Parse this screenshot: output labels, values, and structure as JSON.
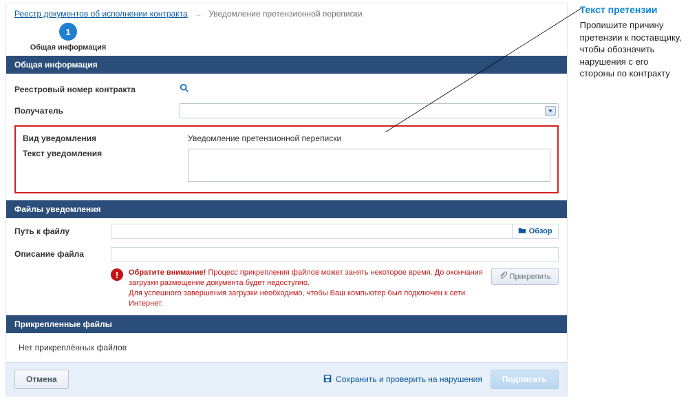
{
  "breadcrumbs": {
    "root": "Реестр документов об исполнении контракта",
    "current": "Уведомление претензионной переписки"
  },
  "step": {
    "num": "1",
    "label": "Общая информация"
  },
  "sections": {
    "general": "Общая информация",
    "files": "Файлы уведомления",
    "attached": "Прикрепленные файлы"
  },
  "fields": {
    "reg_number": "Реестровый номер контракта",
    "recipient": "Получатель",
    "notice_type_label": "Вид уведомления",
    "notice_type_value": "Уведомление претензионной переписки",
    "notice_text_label": "Текст уведомления",
    "file_path": "Путь к файлу",
    "file_desc": "Описание файла"
  },
  "buttons": {
    "browse": "Обзор",
    "attach": "Прикрепить",
    "cancel": "Отмена",
    "check": "Сохранить и проверить на нарушения",
    "submit": "Подписать"
  },
  "warning": {
    "strong": "Обратите внимание!",
    "line1": " Процесс прикрепления файлов может занять некоторое время. До окончания загрузки размещение документа будет недоступно.",
    "line2": "Для успешного завершения загрузки необходимо, чтобы Ваш компьютер был подключен к сети Интернет."
  },
  "attached_empty": "Нет прикреплённых файлов",
  "callout": {
    "title": "Текст претензии",
    "body": "Пропишите причину претензии к поставщику, чтобы обозначить нарушения с его стороны по контракту"
  }
}
